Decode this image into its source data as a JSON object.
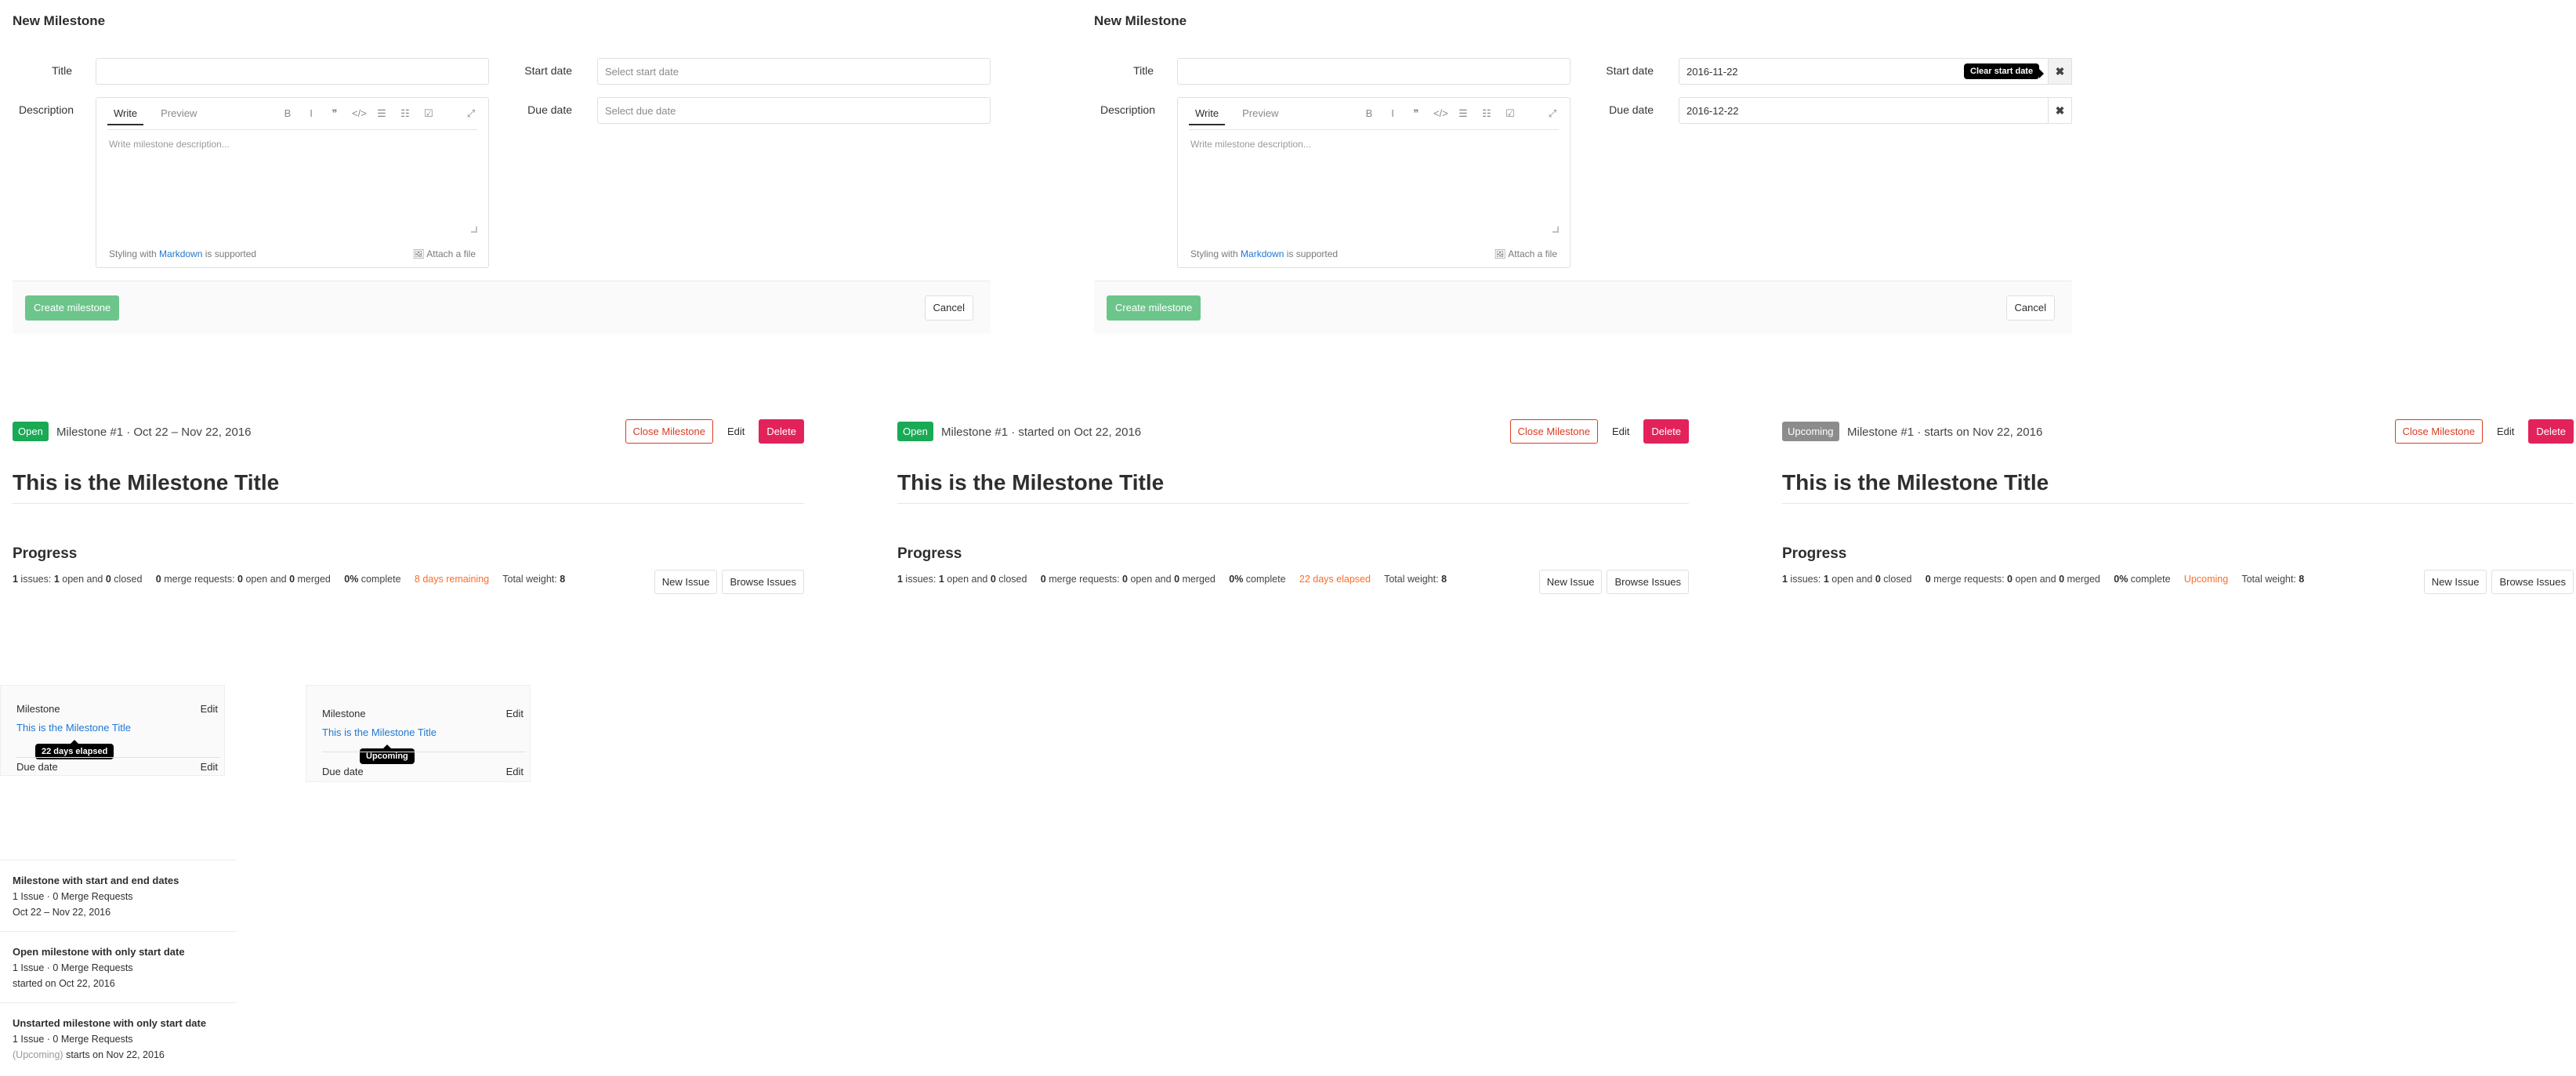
{
  "forms": [
    {
      "heading": "New Milestone",
      "title_label": "Title",
      "title_value": "",
      "description_label": "Description",
      "tab_write": "Write",
      "tab_preview": "Preview",
      "desc_placeholder": "Write milestone description...",
      "footer_prefix": "Styling with ",
      "footer_link": "Markdown",
      "footer_suffix": " is supported",
      "attach": "Attach a file",
      "start_label": "Start date",
      "start_value": "Select start date",
      "due_label": "Due date",
      "due_value": "Select due date",
      "create": "Create milestone",
      "cancel": "Cancel"
    },
    {
      "heading": "New Milestone",
      "title_label": "Title",
      "title_value": "",
      "description_label": "Description",
      "tab_write": "Write",
      "tab_preview": "Preview",
      "desc_placeholder": "Write milestone description...",
      "footer_prefix": "Styling with ",
      "footer_link": "Markdown",
      "footer_suffix": " is supported",
      "attach": "Attach a file",
      "start_label": "Start date",
      "start_value": "2016-11-22",
      "due_label": "Due date",
      "due_value": "2016-12-22",
      "clear_tooltip": "Clear start date",
      "clear_glyph": "✖",
      "create": "Create milestone",
      "cancel": "Cancel"
    }
  ],
  "toolbar_icons": [
    "bold-icon",
    "italic-icon",
    "quote-icon",
    "code-icon",
    "bullet-list-icon",
    "numbered-list-icon",
    "task-list-icon",
    "fullscreen-icon"
  ],
  "toolbar_glyphs": [
    "B",
    "I",
    "❞",
    "</>",
    "☰",
    "☷",
    "☑",
    "⤢"
  ],
  "milestones": [
    {
      "badge": "Open",
      "header": "Milestone #1 · Oct 22 – Nov 22, 2016",
      "close": "Close Milestone",
      "edit": "Edit",
      "delete": "Delete",
      "title": "This is the Milestone Title",
      "progress": "Progress",
      "issues_count": "1",
      "issues_text": " issues: ",
      "open_count": "1",
      "open_text": " open and ",
      "closed_count": "0",
      "closed_text": " closed",
      "mr_count": "0",
      "mr_text": " merge requests: ",
      "mr_open": "0",
      "mr_open_text": " open and ",
      "mr_merged": "0",
      "mr_merged_text": " merged",
      "pct": "0%",
      "pct_text": " complete",
      "status": "8 days remaining",
      "weight_text": "Total weight: ",
      "weight": "8",
      "new_issue": "New Issue",
      "browse": "Browse Issues"
    },
    {
      "badge": "Open",
      "header": "Milestone #1 · started on Oct 22, 2016",
      "close": "Close Milestone",
      "edit": "Edit",
      "delete": "Delete",
      "title": "This is the Milestone Title",
      "progress": "Progress",
      "issues_count": "1",
      "issues_text": " issues: ",
      "open_count": "1",
      "open_text": " open and ",
      "closed_count": "0",
      "closed_text": " closed",
      "mr_count": "0",
      "mr_text": " merge requests: ",
      "mr_open": "0",
      "mr_open_text": " open and ",
      "mr_merged": "0",
      "mr_merged_text": " merged",
      "pct": "0%",
      "pct_text": " complete",
      "status": "22 days elapsed",
      "weight_text": "Total weight: ",
      "weight": "8",
      "new_issue": "New Issue",
      "browse": "Browse Issues"
    },
    {
      "badge": "Upcoming",
      "header": "Milestone #1 · starts on Nov 22, 2016",
      "close": "Close Milestone",
      "edit": "Edit",
      "delete": "Delete",
      "title": "This is the Milestone Title",
      "progress": "Progress",
      "issues_count": "1",
      "issues_text": " issues: ",
      "open_count": "1",
      "open_text": " open and ",
      "closed_count": "0",
      "closed_text": " closed",
      "mr_count": "0",
      "mr_text": " merge requests: ",
      "mr_open": "0",
      "mr_open_text": " open and ",
      "mr_merged": "0",
      "mr_merged_text": " merged",
      "pct": "0%",
      "pct_text": " complete",
      "status": "Upcoming",
      "weight_text": "Total weight: ",
      "weight": "8",
      "new_issue": "New Issue",
      "browse": "Browse Issues"
    }
  ],
  "sidebars": [
    {
      "label": "Milestone",
      "edit": "Edit",
      "link": "This is the Milestone Title",
      "tooltip": "22 days elapsed",
      "due_label": "Due date",
      "due_edit": "Edit"
    },
    {
      "label": "Milestone",
      "edit": "Edit",
      "link": "This is the Milestone Title",
      "tooltip": "Upcoming",
      "due_label": "Due date",
      "due_edit": "Edit"
    }
  ],
  "list": [
    {
      "title": "Milestone with start and end dates",
      "counts": "1 Issue · 0 Merge Requests",
      "dates": "Oct 22 – Nov 22, 2016",
      "prefix": ""
    },
    {
      "title": "Open milestone with only start date",
      "counts": "1 Issue · 0 Merge Requests",
      "dates": "started on Oct 22, 2016",
      "prefix": ""
    },
    {
      "title": "Unstarted milestone with only start date",
      "counts": "1 Issue · 0 Merge Requests",
      "dates": " starts on Nov 22, 2016",
      "prefix": "(Upcoming)"
    }
  ],
  "colors": {
    "accent_link": "#1f78d1",
    "open_green": "#1aaa55",
    "create_green": "#6cc58b",
    "delete_red": "#e2235a",
    "warning_orange": "#fc6d26"
  }
}
